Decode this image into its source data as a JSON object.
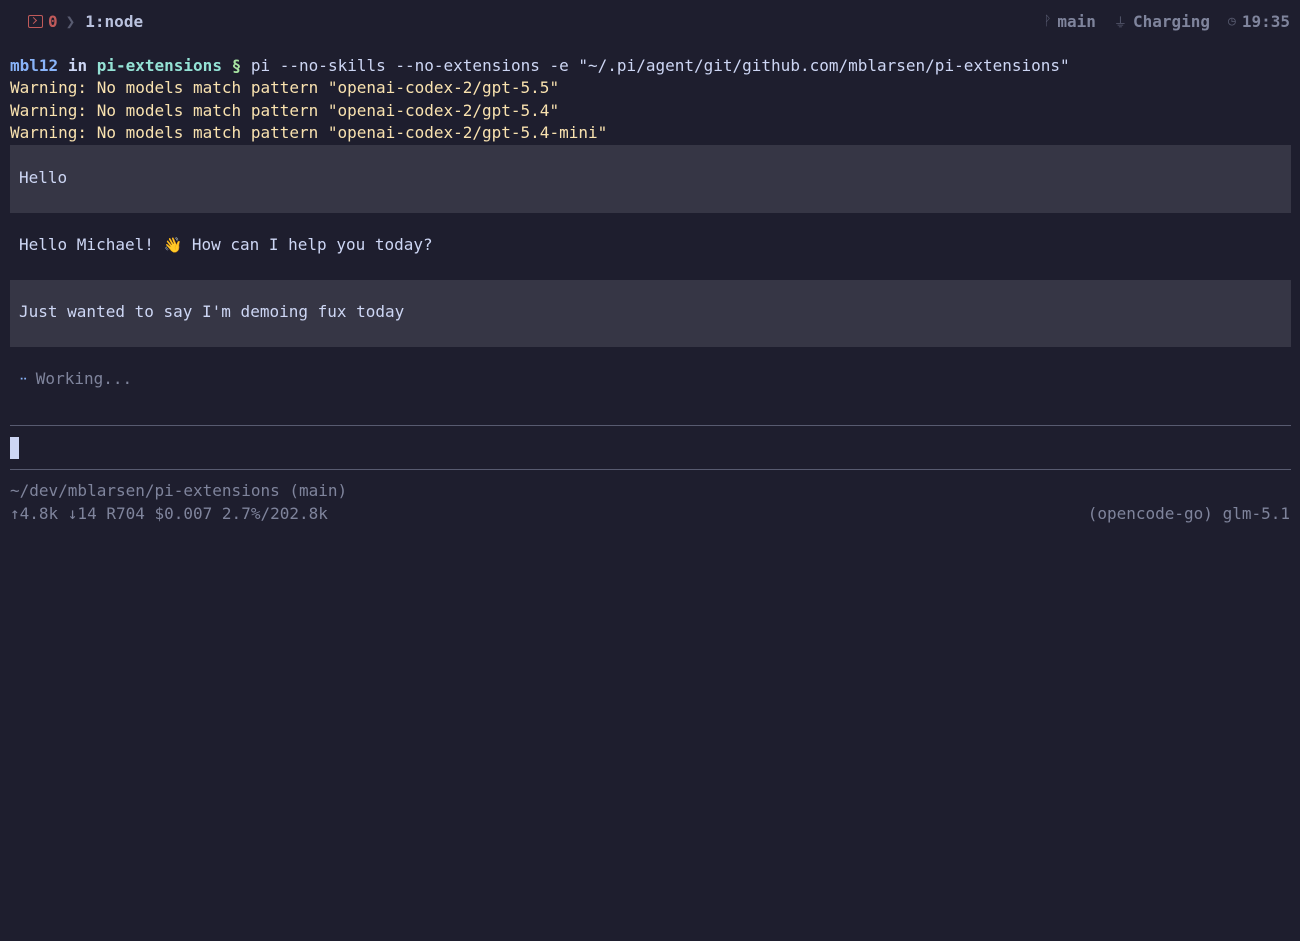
{
  "statusbar": {
    "error_count": "0",
    "window_name": "1:node",
    "git_branch": "main",
    "battery_status": "Charging",
    "time": "19:35"
  },
  "prompt": {
    "user": "mbl12",
    "in": "in",
    "dir": "pi-extensions",
    "symbol": "§",
    "command": "pi --no-skills --no-extensions -e \"~/.pi/agent/git/github.com/mblarsen/pi-extensions\""
  },
  "warnings": [
    "Warning: No models match pattern \"openai-codex-2/gpt-5.5\"",
    "Warning: No models match pattern \"openai-codex-2/gpt-5.4\"",
    "Warning: No models match pattern \"openai-codex-2/gpt-5.4-mini\""
  ],
  "conversation": {
    "user_message_1": "Hello",
    "assistant_message_1_pre": "Hello Michael! ",
    "assistant_message_1_emoji": "👋",
    "assistant_message_1_post": " How can I help you today?",
    "user_message_2": "Just wanted to say I'm demoing fux today",
    "status": "Working..."
  },
  "footer": {
    "path": "~/dev/mblarsen/pi-extensions (main)",
    "stats": "↑4.8k ↓14 R704 $0.007 2.7%/202.8k",
    "model": "(opencode-go) glm-5.1"
  },
  "icons": {
    "terminal": "terminal-icon",
    "git_branch": "git-branch-icon",
    "battery": "plug-icon",
    "clock": "clock-icon"
  }
}
